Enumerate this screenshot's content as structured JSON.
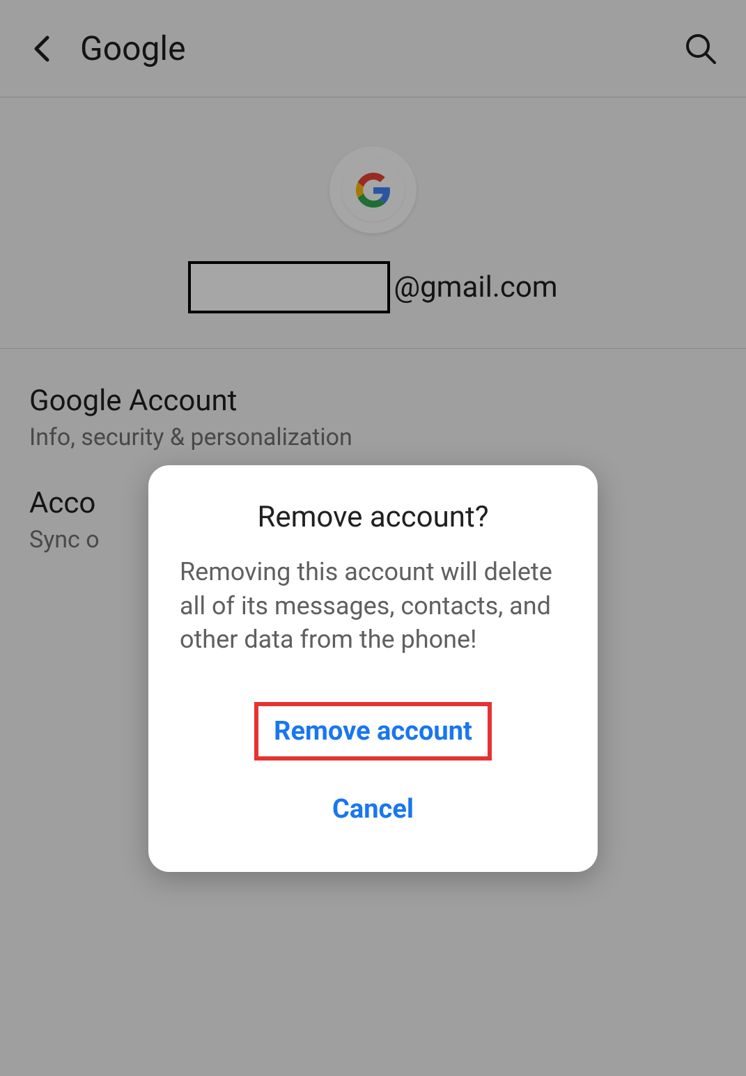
{
  "appBar": {
    "title": "Google"
  },
  "account": {
    "emailSuffix": "@gmail.com"
  },
  "listItems": [
    {
      "title": "Google Account",
      "subtitle": "Info, security & personalization"
    },
    {
      "title": "Acco",
      "subtitle": "Sync o"
    }
  ],
  "dialog": {
    "title": "Remove account?",
    "message": "Removing this account will delete all of its messages, contacts, and other data from the phone!",
    "confirmLabel": "Remove account",
    "cancelLabel": "Cancel"
  }
}
